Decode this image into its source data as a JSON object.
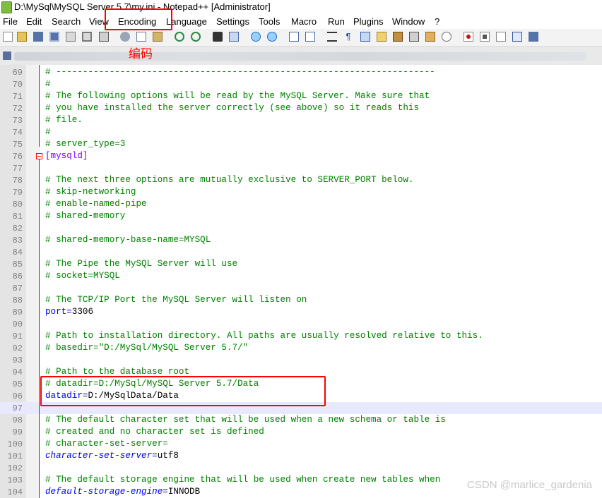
{
  "window": {
    "title": "D:\\MySql\\MySQL Server 5.7\\my.ini - Notepad++ [Administrator]"
  },
  "menubar": {
    "items": [
      {
        "label": "File"
      },
      {
        "label": "Edit"
      },
      {
        "label": "Search"
      },
      {
        "label": "View"
      },
      {
        "label": "Encoding"
      },
      {
        "label": "Language"
      },
      {
        "label": "Settings"
      },
      {
        "label": "Tools"
      },
      {
        "label": "Macro"
      },
      {
        "label": "Run"
      },
      {
        "label": "Plugins"
      },
      {
        "label": "Window"
      },
      {
        "label": "?"
      }
    ]
  },
  "toolbar": {
    "icons": [
      "new-file-icon",
      "open-file-icon",
      "save-icon",
      "save-all-icon",
      "close-icon",
      "close-all-icon",
      "print-icon",
      "cut-icon",
      "copy-icon",
      "paste-icon",
      "undo-icon",
      "redo-icon",
      "find-icon",
      "replace-icon",
      "zoom-in-icon",
      "zoom-out-icon",
      "sync-vertical-icon",
      "sync-horizontal-icon",
      "word-wrap-icon",
      "show-all-chars-icon",
      "indent-guide-icon",
      "user-lang-icon",
      "doc-map-icon",
      "function-list-icon",
      "folder-workspace-icon",
      "monitoring-icon",
      "record-macro-icon",
      "stop-record-icon",
      "play-macro-icon",
      "play-multiple-icon",
      "save-macro-icon"
    ]
  },
  "annotations": {
    "encoding_note": "编码"
  },
  "watermark": "CSDN @marlice_gardenia",
  "colors": {
    "comment": "#008000",
    "section": "#8000ff",
    "key": "#0000ff",
    "annotation": "#ff0000",
    "current_line": "#e8e8ff"
  },
  "editor": {
    "current_line": 97,
    "lines": [
      {
        "n": "69",
        "comment": "# -----------------------------------------------------------------------"
      },
      {
        "n": "70",
        "comment": "#"
      },
      {
        "n": "71",
        "comment": "# The following options will be read by the MySQL Server. Make sure that"
      },
      {
        "n": "72",
        "comment": "# you have installed the server correctly (see above) so it reads this"
      },
      {
        "n": "73",
        "comment": "# file."
      },
      {
        "n": "74",
        "comment": "#"
      },
      {
        "n": "75",
        "comment": "# server_type=3"
      },
      {
        "n": "76",
        "section": "[mysqld]"
      },
      {
        "n": "77"
      },
      {
        "n": "78",
        "comment": "# The next three options are mutually exclusive to SERVER_PORT below."
      },
      {
        "n": "79",
        "comment": "# skip-networking"
      },
      {
        "n": "80",
        "comment": "# enable-named-pipe"
      },
      {
        "n": "81",
        "comment": "# shared-memory"
      },
      {
        "n": "82"
      },
      {
        "n": "83",
        "comment": "# shared-memory-base-name=MYSQL"
      },
      {
        "n": "84"
      },
      {
        "n": "85",
        "comment": "# The Pipe the MySQL Server will use"
      },
      {
        "n": "86",
        "comment": "# socket=MYSQL"
      },
      {
        "n": "87"
      },
      {
        "n": "88",
        "comment": "# The TCP/IP Port the MySQL Server will listen on"
      },
      {
        "n": "89",
        "key": "port",
        "value": "3306"
      },
      {
        "n": "90"
      },
      {
        "n": "91",
        "comment": "# Path to installation directory. All paths are usually resolved relative to this."
      },
      {
        "n": "92",
        "comment": "# basedir=\"D:/MySql/MySQL Server 5.7/\""
      },
      {
        "n": "93"
      },
      {
        "n": "94",
        "comment": "# Path to the database root"
      },
      {
        "n": "95",
        "comment": "# datadir=D:/MySql/MySQL Server 5.7/Data"
      },
      {
        "n": "96",
        "key": "datadir",
        "value": "D:/MySqlData/Data"
      },
      {
        "n": "97"
      },
      {
        "n": "98",
        "comment": "# The default character set that will be used when a new schema or table is"
      },
      {
        "n": "99",
        "comment": "# created and no character set is defined"
      },
      {
        "n": "100",
        "comment": "# character-set-server="
      },
      {
        "n": "101",
        "key": "character-set-server",
        "value": "utf8",
        "italic": true
      },
      {
        "n": "102"
      },
      {
        "n": "103",
        "comment": "# The default storage engine that will be used when create new tables when"
      },
      {
        "n": "104",
        "key": "default-storage-engine",
        "value": "INNODB",
        "italic": true
      }
    ]
  }
}
